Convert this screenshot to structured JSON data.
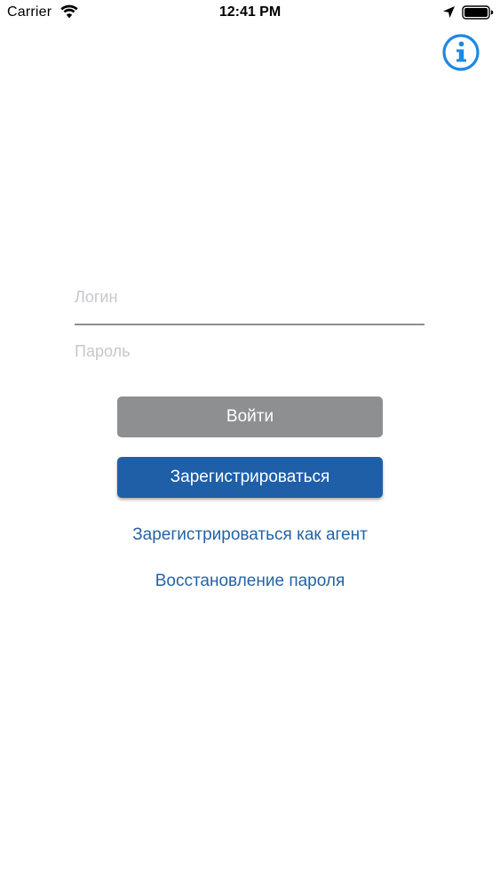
{
  "status_bar": {
    "carrier": "Carrier",
    "time": "12:41 PM",
    "wifi_icon": "wifi-icon",
    "location_icon": "location-arrow-icon",
    "battery_icon": "battery-icon"
  },
  "header": {
    "info_icon": "info-icon"
  },
  "form": {
    "login_placeholder": "Логин",
    "login_value": "",
    "password_placeholder": "Пароль",
    "password_value": ""
  },
  "actions": {
    "login_label": "Войти",
    "register_label": "Зарегистрироваться",
    "register_agent_label": "Зарегистрироваться как агент",
    "recover_password_label": "Восстановление пароля"
  },
  "colors": {
    "accent": "#1f5fa8",
    "link": "#2563a3",
    "disabled_button": "#8e8f91",
    "placeholder": "#c7c7cd",
    "info_icon": "#1e88e5"
  }
}
